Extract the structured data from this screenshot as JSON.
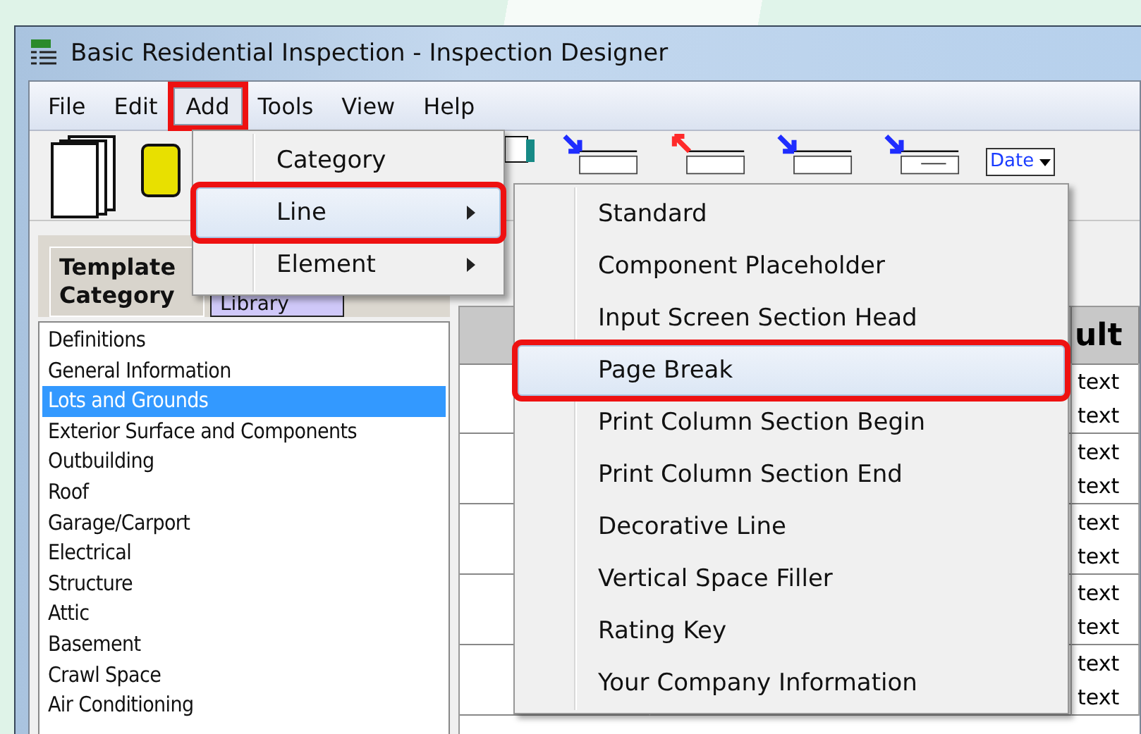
{
  "window": {
    "title": "Basic Residential Inspection - Inspection Designer"
  },
  "menu_bar": [
    {
      "label": "File",
      "selected": false,
      "annotated": false
    },
    {
      "label": "Edit",
      "selected": false,
      "annotated": false
    },
    {
      "label": "Add",
      "selected": true,
      "annotated": true
    },
    {
      "label": "Tools",
      "selected": false,
      "annotated": false
    },
    {
      "label": "View",
      "selected": false,
      "annotated": false
    },
    {
      "label": "Help",
      "selected": false,
      "annotated": false
    }
  ],
  "add_menu": [
    {
      "label": "Category",
      "submenu": false,
      "selected": false,
      "annotated": false
    },
    {
      "label": "Line",
      "submenu": true,
      "selected": true,
      "annotated": true
    },
    {
      "label": "Element",
      "submenu": true,
      "selected": false,
      "annotated": false
    }
  ],
  "line_submenu": [
    {
      "label": "Standard",
      "selected": false,
      "annotated": false
    },
    {
      "label": "Component Placeholder",
      "selected": false,
      "annotated": false
    },
    {
      "label": "Input Screen Section Head",
      "selected": false,
      "annotated": false
    },
    {
      "label": "Page Break",
      "selected": true,
      "annotated": true
    },
    {
      "label": "Print Column Section Begin",
      "selected": false,
      "annotated": false
    },
    {
      "label": "Print Column Section End",
      "selected": false,
      "annotated": false
    },
    {
      "label": "Decorative Line",
      "selected": false,
      "annotated": false
    },
    {
      "label": "Vertical Space Filler",
      "selected": false,
      "annotated": false
    },
    {
      "label": "Rating Key",
      "selected": false,
      "annotated": false
    },
    {
      "label": "Your Company Information",
      "selected": false,
      "annotated": false
    }
  ],
  "toolbar": {
    "date_combo": "Date"
  },
  "tabs": [
    {
      "label": "Template Category",
      "selected": true
    },
    {
      "label": "Library",
      "selected": false
    }
  ],
  "category_list": [
    {
      "label": "Definitions",
      "selected": false
    },
    {
      "label": "General Information",
      "selected": false
    },
    {
      "label": "Lots and Grounds",
      "selected": true
    },
    {
      "label": "Exterior Surface and Components",
      "selected": false
    },
    {
      "label": "Outbuilding",
      "selected": false
    },
    {
      "label": "Roof",
      "selected": false
    },
    {
      "label": "Garage/Carport",
      "selected": false
    },
    {
      "label": "Electrical",
      "selected": false
    },
    {
      "label": "Structure",
      "selected": false
    },
    {
      "label": "Attic",
      "selected": false
    },
    {
      "label": "Basement",
      "selected": false
    },
    {
      "label": "Crawl Space",
      "selected": false
    },
    {
      "label": "Air Conditioning",
      "selected": false
    }
  ],
  "grid": {
    "column_header": "ult",
    "rows": [
      {
        "lines": [
          "text",
          "text"
        ]
      },
      {
        "lines": [
          "text",
          "text"
        ]
      },
      {
        "lines": [
          "text",
          "text"
        ]
      },
      {
        "lines": [
          "text",
          "text"
        ]
      },
      {
        "lines": [
          "text",
          "text"
        ]
      }
    ]
  }
}
